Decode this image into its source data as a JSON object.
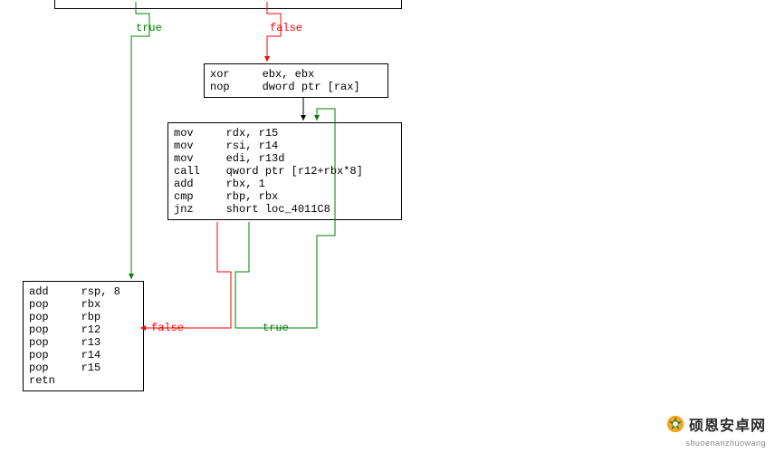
{
  "diagram": {
    "type": "control-flow-graph",
    "tool": "IDA Pro disassembler (graph view)",
    "edges": {
      "topTrueLabel": "true",
      "topFalseLabel": "false",
      "loopTrueLabel": "true",
      "loopFalseLabel": "false"
    },
    "blocks": {
      "topCut": {
        "note": "partially visible predecessor block at top edge",
        "lines": []
      },
      "xorBlock": {
        "lines": [
          "xor     ebx, ebx",
          "nop     dword ptr [rax]"
        ]
      },
      "loopBody": {
        "lines": [
          "mov     rdx, r15",
          "mov     rsi, r14",
          "mov     edi, r13d",
          "call    qword ptr [r12+rbx*8]",
          "add     rbx, 1",
          "cmp     rbp, rbx",
          "jnz     short loc_4011C8"
        ]
      },
      "epilogue": {
        "lines": [
          "add     rsp, 8",
          "pop     rbx",
          "pop     rbp",
          "pop     r12",
          "pop     r13",
          "pop     r14",
          "pop     r15",
          "retn"
        ]
      }
    }
  },
  "watermark": {
    "title": "硕恩安卓网",
    "subtitle": "shuoenanzhuowang"
  }
}
